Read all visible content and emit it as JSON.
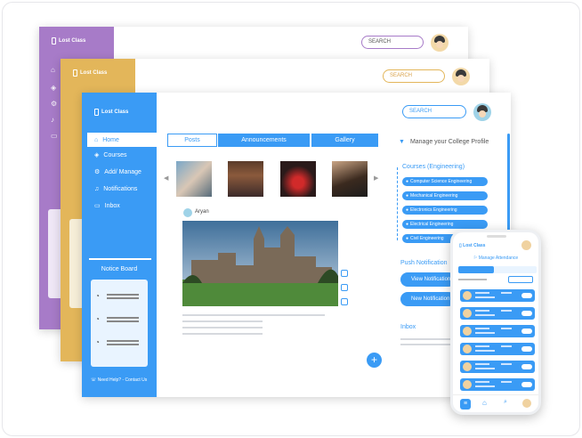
{
  "brand": "Lost Class",
  "search_placeholder": "SEARCH",
  "colors": {
    "purple": "#a77bc8",
    "yellow": "#e3b65a",
    "blue": "#3a9bf5",
    "light": "#e9f4ff"
  },
  "sidebar": {
    "items": [
      {
        "label": "Home",
        "icon": "home-icon"
      },
      {
        "label": "Courses",
        "icon": "layers-icon"
      },
      {
        "label": "Add/ Manage",
        "icon": "gear-icon"
      },
      {
        "label": "Notifications",
        "icon": "bell-icon"
      },
      {
        "label": "Inbox",
        "icon": "inbox-icon"
      }
    ],
    "notice_board": "Notice Board",
    "help": "Need Help? - Contact Us"
  },
  "main": {
    "tabs": [
      "Posts",
      "Announcements",
      "Gallery"
    ],
    "post_author": "Aryan"
  },
  "right_panel": {
    "manage": "Manage your College Profile",
    "courses_title": "Courses (Engineering)",
    "courses": [
      "Computer Science Engineering",
      "Mechanical Engineering",
      "Electronics Engineering",
      "Electrical Engineering",
      "Civil Engineering"
    ],
    "push_title": "Push Notification",
    "btn_view": "View Notification",
    "btn_new": "New Notification",
    "inbox": "Inbox"
  },
  "phone": {
    "brand": "Lost Class",
    "header": "Manage Attendance"
  }
}
